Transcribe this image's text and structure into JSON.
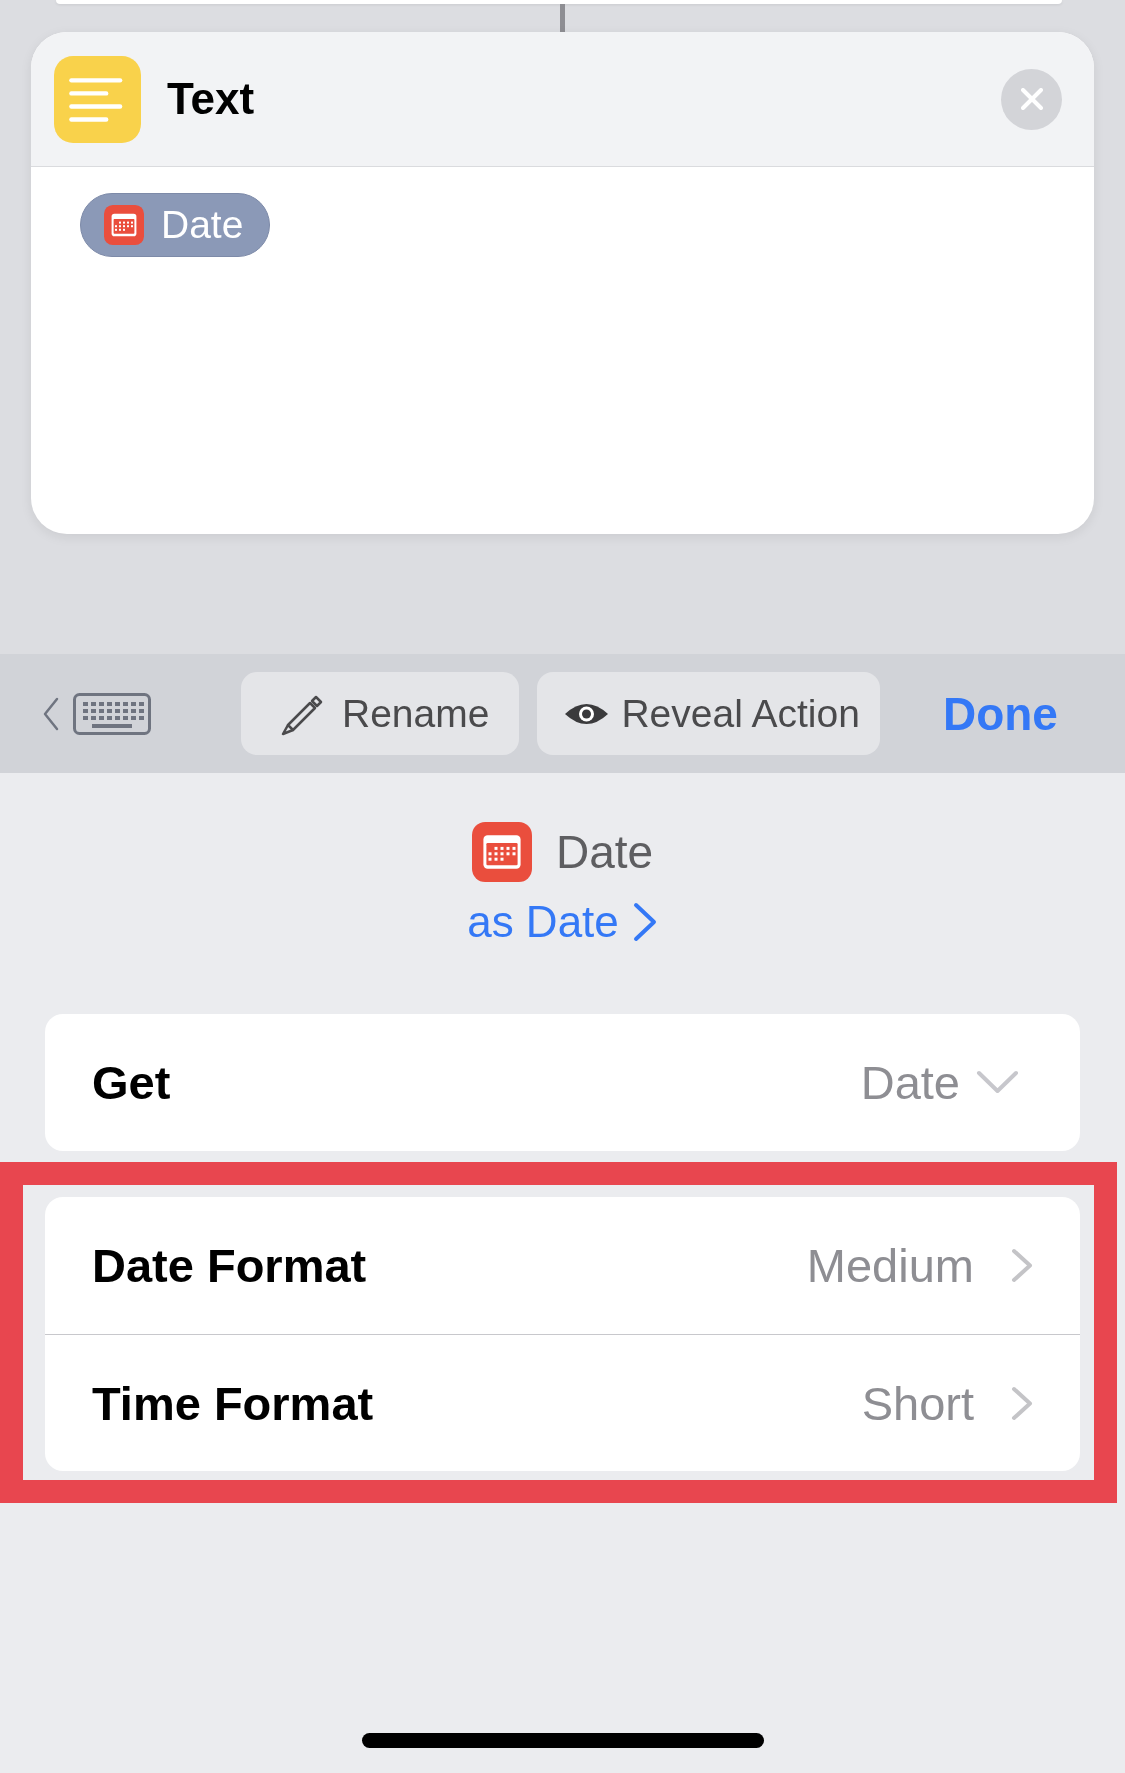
{
  "action_card": {
    "title": "Text",
    "token": {
      "label": "Date"
    }
  },
  "toolbar": {
    "buttons": [
      {
        "kind": "rename",
        "label": "Rename"
      },
      {
        "kind": "reveal",
        "label": "Reveal Action"
      }
    ],
    "done": "Done"
  },
  "variable": {
    "name": "Date",
    "type_link": "as Date"
  },
  "groups": [
    {
      "highlighted": false,
      "rows": [
        {
          "kind": "menu",
          "label": "Get",
          "value": "Date"
        }
      ]
    },
    {
      "highlighted": true,
      "rows": [
        {
          "kind": "disclosure",
          "label": "Date Format",
          "value": "Medium"
        },
        {
          "kind": "disclosure",
          "label": "Time Format",
          "value": "Short"
        }
      ]
    }
  ]
}
